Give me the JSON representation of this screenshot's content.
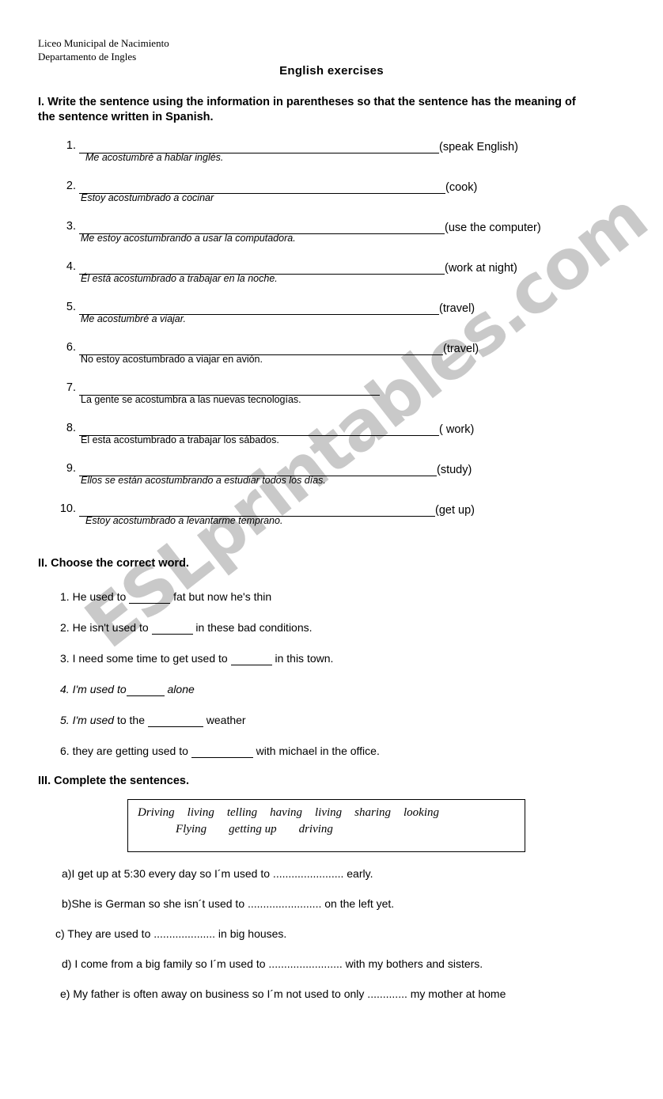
{
  "header": {
    "school_line1": "Liceo Municipal de Nacimiento",
    "school_line2": "Departamento de Ingles",
    "title": "English exercises"
  },
  "watermark": {
    "text": "ESLprintables.com",
    "color": "#c9c9c9"
  },
  "section1": {
    "heading": "I. Write the sentence using the information in parentheses so that the sentence has the meaning of the sentence written in Spanish.",
    "items": [
      {
        "number": "1.",
        "rule_width": 455,
        "hint": "(speak English)",
        "spanish": "Me acostumbré a hablar inglés.",
        "italic": true,
        "indent": true
      },
      {
        "number": "2.",
        "rule_width": 463,
        "hint": " (cook)",
        "spanish": "Estoy acostumbrado a cocinar",
        "italic": true,
        "indent": false
      },
      {
        "number": "3.",
        "rule_width": 462,
        "hint": "  (use the computer)",
        "spanish": "Me estoy acostumbrando a usar la computadora.",
        "italic": true,
        "indent": false
      },
      {
        "number": "4.",
        "rule_width": 462,
        "hint": "(work at night)",
        "spanish": "Él está acostumbrado a trabajar en la noche.",
        "italic": true,
        "indent": false
      },
      {
        "number": "5.",
        "rule_width": 455,
        "hint": "(travel)",
        "spanish": "Me acostumbré a viajar.",
        "italic": true,
        "indent": false
      },
      {
        "number": "6.",
        "rule_width": 460,
        "hint": " (travel)",
        "spanish": "No estoy acostumbrado a viajar en avión.",
        "italic": false,
        "indent": false
      },
      {
        "number": "7.",
        "rule_width": 380,
        "hint": "",
        "spanish": "La gente se acostumbra a las nuevas tecnologías.",
        "italic": false,
        "indent": false
      },
      {
        "number": "8.",
        "rule_width": 455,
        "hint": " ( work)",
        "spanish": "El esta acostumbrado a trabajar los sábados.",
        "italic": false,
        "indent": false
      },
      {
        "number": "9.",
        "rule_width": 452,
        "hint": " (study)",
        "spanish": "Ellos se están acostumbrando a estudiar todos los días.",
        "italic": true,
        "indent": false
      },
      {
        "number": "10.",
        "rule_width": 450,
        "hint": " (get up)",
        "spanish": "Estoy acostumbrado a levantarme temprano.",
        "italic": true,
        "indent": true
      }
    ]
  },
  "section2": {
    "heading": "II. Choose the correct word.",
    "items": [
      {
        "number": "1.",
        "before": " He used to  ",
        "blank_width": 52,
        "after": "  fat but now he's thin",
        "style": "plain"
      },
      {
        "number": "2.",
        "before": " He isn't used to ",
        "blank_width": 52,
        "after": " in these bad conditions.",
        "style": "plain"
      },
      {
        "number": "3.",
        "before": " I need some time to get used to ",
        "blank_width": 52,
        "after": " in this town.",
        "style": "plain"
      },
      {
        "number": "4.",
        "before": " I'm used to",
        "blank_width": 48,
        "after": " alone",
        "style": "all-italic"
      },
      {
        "number": "5.",
        "before": " I'm used",
        "mid": " to the ",
        "blank_width": 70,
        "after": " weather",
        "style": "lead-italic"
      },
      {
        "number": "6.",
        "before": " they are getting used to ",
        "blank_width": 78,
        "after": " with michael in the office.",
        "style": "plain"
      }
    ]
  },
  "section3": {
    "heading": "III. Complete the sentences.",
    "word_box": {
      "row1": [
        "Driving",
        "living",
        "telling",
        "having",
        "living",
        "sharing",
        "looking"
      ],
      "row2": [
        "Flying",
        "getting up",
        "driving"
      ]
    },
    "items": [
      {
        "label": "a)",
        "text": "a)I get up at 5:30 every day so I´m used to  ....................... early."
      },
      {
        "label": "b)",
        "text": "b)She is German so she isn´t used to ........................ on the left yet."
      },
      {
        "label": "c)",
        "text": "c) They are used to .................... in big houses."
      },
      {
        "label": "d)",
        "text": "d) I come from a big family so I´m used to ........................ with my bothers and sisters."
      },
      {
        "label": "e)",
        "text": "e) My father is often away on business so I´m not used to only ............. my mother at home"
      }
    ]
  }
}
